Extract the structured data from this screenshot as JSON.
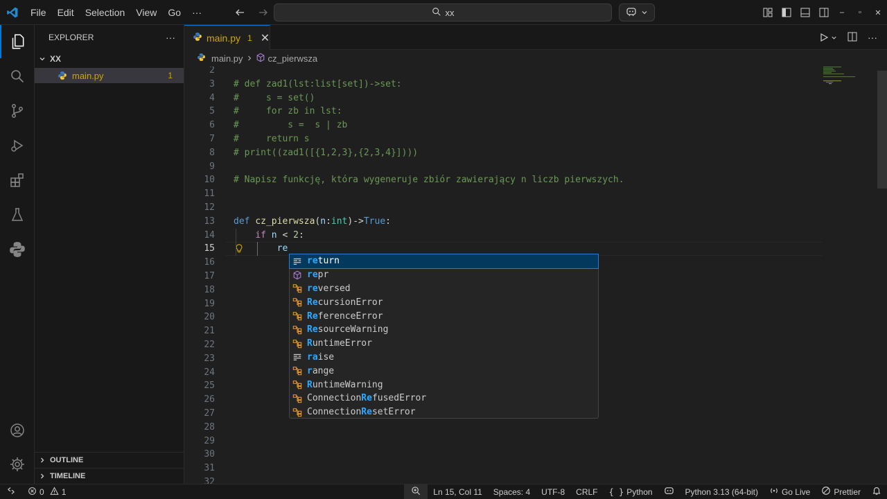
{
  "menu": [
    "File",
    "Edit",
    "Selection",
    "View",
    "Go",
    "···"
  ],
  "search": {
    "text": "xx"
  },
  "activity_bar": [
    "explorer-icon",
    "search-icon",
    "source-control-icon",
    "run-debug-icon",
    "extensions-icon",
    "testing-icon",
    "python-icon",
    "account-icon",
    "settings-gear-icon"
  ],
  "sidebar": {
    "title": "EXPLORER",
    "more": "···",
    "folder": "XX",
    "file": "main.py",
    "file_badge": "1",
    "outline": "OUTLINE",
    "timeline": "TIMELINE"
  },
  "tab": {
    "label": "main.py",
    "count": "1",
    "close": "✕"
  },
  "breadcrumb": {
    "file": "main.py",
    "symbol": "cz_pierwsza"
  },
  "editor": {
    "cursor_line": 15,
    "lines": [
      {
        "n": "2",
        "text": ""
      },
      {
        "n": "3",
        "text": "# def zad1(lst:list[set])->set:"
      },
      {
        "n": "4",
        "text": "#     s = set()"
      },
      {
        "n": "5",
        "text": "#     for zb in lst:"
      },
      {
        "n": "6",
        "text": "#         s =  s | zb"
      },
      {
        "n": "7",
        "text": "#     return s"
      },
      {
        "n": "8",
        "text": "# print((zad1([{1,2,3},{2,3,4}])))"
      },
      {
        "n": "9",
        "text": ""
      },
      {
        "n": "10",
        "text": "# Napisz funkcję, która wygeneruje zbiór zawierający n liczb pierwszych."
      },
      {
        "n": "11",
        "text": ""
      },
      {
        "n": "12",
        "text": ""
      },
      {
        "n": "13",
        "text": "def cz_pierwsza(n:int)->True:"
      },
      {
        "n": "14",
        "text": "    if n < 2:"
      },
      {
        "n": "15",
        "text": "        re"
      },
      {
        "n": "16",
        "text": ""
      },
      {
        "n": "17",
        "text": ""
      },
      {
        "n": "18",
        "text": ""
      },
      {
        "n": "19",
        "text": ""
      },
      {
        "n": "20",
        "text": ""
      },
      {
        "n": "21",
        "text": ""
      },
      {
        "n": "22",
        "text": ""
      },
      {
        "n": "23",
        "text": ""
      },
      {
        "n": "24",
        "text": ""
      },
      {
        "n": "25",
        "text": ""
      },
      {
        "n": "26",
        "text": ""
      },
      {
        "n": "27",
        "text": ""
      },
      {
        "n": "28",
        "text": ""
      },
      {
        "n": "29",
        "text": ""
      },
      {
        "n": "30",
        "text": ""
      },
      {
        "n": "31",
        "text": ""
      },
      {
        "n": "32",
        "text": ""
      }
    ]
  },
  "suggestions": [
    {
      "pre": "",
      "hl": "re",
      "post": "turn",
      "kind": "keyword",
      "selected": true
    },
    {
      "pre": "",
      "hl": "re",
      "post": "pr",
      "kind": "module",
      "selected": false
    },
    {
      "pre": "",
      "hl": "re",
      "post": "versed",
      "kind": "class",
      "selected": false
    },
    {
      "pre": "",
      "hl": "Re",
      "post": "cursionError",
      "kind": "class",
      "selected": false
    },
    {
      "pre": "",
      "hl": "Re",
      "post": "ferenceError",
      "kind": "class",
      "selected": false
    },
    {
      "pre": "",
      "hl": "Re",
      "post": "sourceWarning",
      "kind": "class",
      "selected": false
    },
    {
      "pre": "",
      "hl": "R",
      "post": "untimeError",
      "kind": "class",
      "selected": false
    },
    {
      "pre": "",
      "hl": "ra",
      "post": "ise",
      "kind": "keyword",
      "selected": false
    },
    {
      "pre": "",
      "hl": "r",
      "post": "ange",
      "kind": "class",
      "selected": false
    },
    {
      "pre": "",
      "hl": "R",
      "post": "untimeWarning",
      "kind": "class",
      "selected": false
    },
    {
      "pre": "Connection",
      "hl": "Re",
      "post": "fusedError",
      "kind": "class",
      "selected": false
    },
    {
      "pre": "Connection",
      "hl": "Re",
      "post": "setError",
      "kind": "class",
      "selected": false
    }
  ],
  "status": {
    "errors": "0",
    "warnings": "1",
    "position": "Ln 15, Col 11",
    "spaces": "Spaces: 4",
    "encoding": "UTF-8",
    "eol": "CRLF",
    "language": "Python",
    "interpreter": "Python 3.13 (64-bit)",
    "golive": "Go Live",
    "prettier": "Prettier"
  },
  "colors": {
    "accent": "#0078d4",
    "warning": "#cca700",
    "selection": "#04395e"
  }
}
